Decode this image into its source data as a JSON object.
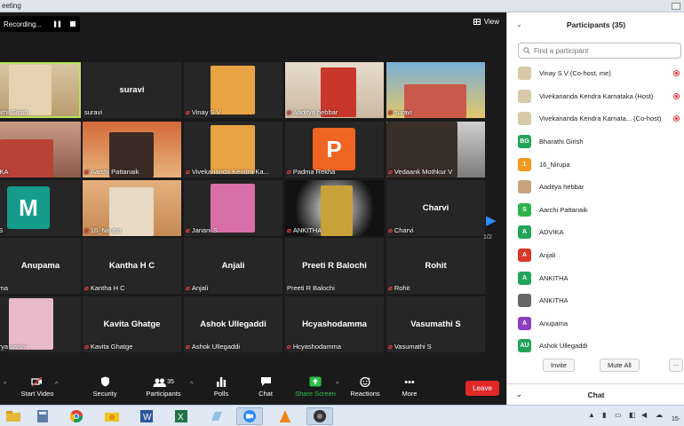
{
  "window": {
    "title": "eeting"
  },
  "recording": {
    "label": "Recording...",
    "pause_icon": "pause-icon",
    "stop_icon": "stop-icon"
  },
  "view": {
    "label": "View",
    "icon": "grid-view-icon"
  },
  "tiles": [
    {
      "label": "Bharathi Girish",
      "display": "",
      "muted": false,
      "kind": "video"
    },
    {
      "label": "suravi",
      "display": "suravi",
      "muted": false,
      "kind": "name"
    },
    {
      "label": "Vinay S V",
      "display": "",
      "muted": true,
      "kind": "picture"
    },
    {
      "label": "Aaditya hebbar",
      "display": "",
      "muted": true,
      "kind": "video"
    },
    {
      "label": "suravi",
      "display": "",
      "muted": true,
      "kind": "video"
    },
    {
      "label": "ADVIKA",
      "display": "",
      "muted": false,
      "kind": "video"
    },
    {
      "label": "Aarchi Pattanaik",
      "display": "",
      "muted": true,
      "kind": "video"
    },
    {
      "label": "Vivekananda Kendra Ka...",
      "display": "",
      "muted": true,
      "kind": "picture"
    },
    {
      "label": "Padma Rekha",
      "display": "P",
      "muted": true,
      "kind": "avatar"
    },
    {
      "label": "Vedaank Mothkur V",
      "display": "",
      "muted": true,
      "kind": "video"
    },
    {
      "label": "onal S",
      "display": "M",
      "muted": false,
      "kind": "avatar"
    },
    {
      "label": "16_Nirupa",
      "display": "",
      "muted": true,
      "kind": "video"
    },
    {
      "label": "Janani S",
      "display": "",
      "muted": true,
      "kind": "video"
    },
    {
      "label": "ANKITHA",
      "display": "",
      "muted": true,
      "kind": "video"
    },
    {
      "label": "Charvi",
      "display": "Charvi",
      "muted": true,
      "kind": "name"
    },
    {
      "label": "nupama",
      "display": "Anupama",
      "muted": false,
      "kind": "name"
    },
    {
      "label": "Kantha H C",
      "display": "Kantha H C",
      "muted": true,
      "kind": "name"
    },
    {
      "label": "Anjali",
      "display": "Anjali",
      "muted": true,
      "kind": "name"
    },
    {
      "label": "Preeti R Balochi",
      "display": "Preeti R Balochi",
      "muted": false,
      "kind": "name"
    },
    {
      "label": "Rohit",
      "display": "Rohit",
      "muted": true,
      "kind": "name"
    },
    {
      "label": "undarya sanvi",
      "display": "",
      "muted": false,
      "kind": "picture"
    },
    {
      "label": "Kavita Ghatge",
      "display": "Kavita Ghatge",
      "muted": true,
      "kind": "name"
    },
    {
      "label": "Ashok Ullegaddi",
      "display": "Ashok Ullegaddi",
      "muted": true,
      "kind": "name"
    },
    {
      "label": "Hcyashodamma",
      "display": "Hcyashodamma",
      "muted": true,
      "kind": "name"
    },
    {
      "label": "Vasumathi S",
      "display": "Vasumathi S",
      "muted": true,
      "kind": "name"
    }
  ],
  "pager": {
    "label": "1/2",
    "icon": "next-page-arrow-icon"
  },
  "toolbar": {
    "start_video": "Start Video",
    "security": "Security",
    "participants": "Participants",
    "participants_count": "35",
    "polls": "Polls",
    "chat": "Chat",
    "share_screen": "Share Screen",
    "reactions": "Reactions",
    "more": "More",
    "leave": "Leave"
  },
  "panel": {
    "title": "Participants (35)",
    "search_placeholder": "Find a participant",
    "participants": [
      {
        "name": "Vinay S V (Co-host, me)",
        "initials": "",
        "color": "#d8c9a8",
        "recording": true
      },
      {
        "name": "Vivekananda Kendra Karnataka (Host)",
        "initials": "",
        "color": "#d8c9a8",
        "recording": true
      },
      {
        "name": "Vivekananda Kendra Karnata... (Co-host)",
        "initials": "",
        "color": "#d8c9a8",
        "recording": true
      },
      {
        "name": "Bharathi Girish",
        "initials": "BG",
        "color": "#22a559",
        "recording": false
      },
      {
        "name": "16_Nirupa",
        "initials": "1",
        "color": "#f29a1e",
        "recording": false
      },
      {
        "name": "Aaditya hebbar",
        "initials": "",
        "color": "#c9a27b",
        "recording": false
      },
      {
        "name": "Aarchi Pattanaik",
        "initials": "S",
        "color": "#2db34a",
        "recording": false
      },
      {
        "name": "ADVIKA",
        "initials": "A",
        "color": "#22a559",
        "recording": false
      },
      {
        "name": "Anjali",
        "initials": "A",
        "color": "#d9382b",
        "recording": false
      },
      {
        "name": "ANKITHA",
        "initials": "A",
        "color": "#22a559",
        "recording": false
      },
      {
        "name": "ANKITHA",
        "initials": "",
        "color": "#666666",
        "recording": false
      },
      {
        "name": "Anupama",
        "initials": "A",
        "color": "#8a3fc1",
        "recording": false
      },
      {
        "name": "Ashok Ullegaddi",
        "initials": "AU",
        "color": "#22a559",
        "recording": false
      }
    ],
    "invite": "Invite",
    "mute_all": "Mute All",
    "more": "...",
    "chat": "Chat"
  },
  "taskbar": {
    "clock": "15-"
  },
  "colors": {
    "accent_blue": "#2d8cff",
    "leave_red": "#e02828",
    "share_green": "#2ec24a",
    "active_speaker": "#b7e35a"
  }
}
